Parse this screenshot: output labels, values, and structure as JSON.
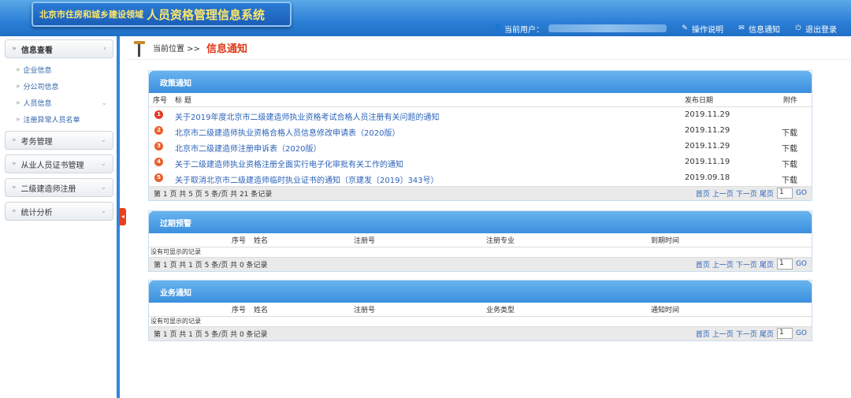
{
  "header": {
    "subtitle": "北京市住房和城乡建设领域",
    "title": "人员资格管理信息系统",
    "current_user_label": "当前用户：",
    "help": "操作说明",
    "notice": "信息通知",
    "logout": "退出登录"
  },
  "sidebar": {
    "sections": [
      {
        "label": "信息查看"
      },
      {
        "label": "考务管理"
      },
      {
        "label": "从业人员证书管理"
      },
      {
        "label": "二级建造师注册"
      },
      {
        "label": "统计分析"
      }
    ],
    "sub_items": [
      "企业信息",
      "分公司信息",
      "人员信息",
      "注册异常人员名单"
    ]
  },
  "breadcrumb": {
    "prefix": "当前位置 >>",
    "current": "信息通知"
  },
  "policy": {
    "title": "政策通知",
    "cols": {
      "no": "序号",
      "title": "标 题",
      "date": "发布日期",
      "attach": "附件"
    },
    "rows": [
      {
        "no": "1",
        "title": "关于2019年度北京市二级建造师执业资格考试合格人员注册有关问题的通知",
        "date": "2019.11.29",
        "attach": ""
      },
      {
        "no": "2",
        "title": "北京市二级建造师执业资格合格人员信息修改申请表（2020版）",
        "date": "2019.11.29",
        "attach": "下载"
      },
      {
        "no": "3",
        "title": "北京市二级建造师注册申诉表（2020版）",
        "date": "2019.11.29",
        "attach": "下载"
      },
      {
        "no": "4",
        "title": "关于二级建造师执业资格注册全面实行电子化审批有关工作的通知",
        "date": "2019.11.19",
        "attach": "下载"
      },
      {
        "no": "5",
        "title": "关于取消北京市二级建造师临时执业证书的通知（京建发〔2019〕343号）",
        "date": "2019.09.18",
        "attach": "下载"
      }
    ],
    "pager_text": "第 1 页   共 5 页   5 条/页     共  21 条记录"
  },
  "expiry": {
    "title": "过期预警",
    "cols": {
      "no": "序号",
      "name": "姓名",
      "reg": "注册号",
      "major": "注册专业",
      "date": "到期时间"
    },
    "empty": "没有可显示的记录",
    "pager_text": "第 1 页   共 1 页   5 条/页     共  0 条记录"
  },
  "business": {
    "title": "业务通知",
    "cols": {
      "no": "序号",
      "name": "姓名",
      "reg": "注册号",
      "type": "业务类型",
      "date": "通知时间"
    },
    "empty": "没有可显示的记录",
    "pager_text": "第 1 页   共 1 页   5 条/页     共  0 条记录"
  },
  "pager_links": {
    "first": "首页",
    "prev": "上一页",
    "next": "下一页",
    "last": "尾页",
    "page": "1",
    "go": "GO"
  },
  "colors": {
    "accent": "#2f86dd",
    "num": [
      "#e53a2a",
      "#e8602c",
      "#e8602c",
      "#e8602c",
      "#e8602c"
    ]
  }
}
